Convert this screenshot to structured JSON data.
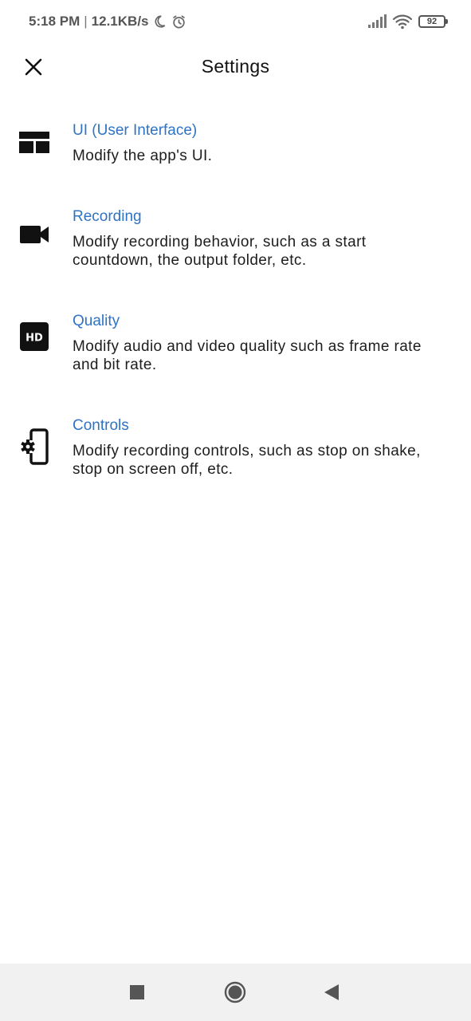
{
  "status_bar": {
    "time": "5:18 PM",
    "separator": "|",
    "net_speed": "12.1KB/s",
    "battery_level": "92",
    "icons": [
      "moon-icon",
      "alarm-icon",
      "signal-icon",
      "wifi-icon",
      "battery-icon"
    ]
  },
  "app_bar": {
    "title": "Settings",
    "close_icon": "close-icon"
  },
  "settings": {
    "accent_color": "#2f73c4",
    "items": [
      {
        "icon": "layout-icon",
        "title": "UI (User Interface)",
        "description": "Modify the app's UI."
      },
      {
        "icon": "videocam-icon",
        "title": "Recording",
        "description": "Modify recording behavior, such as a start countdown, the output folder, etc."
      },
      {
        "icon": "hd-icon",
        "title": "Quality",
        "description": "Modify audio and video quality such as frame rate and bit rate."
      },
      {
        "icon": "phone-settings-icon",
        "title": "Controls",
        "description": "Modify recording controls, such as stop on shake, stop on screen off, etc."
      }
    ]
  },
  "nav_bar": {
    "buttons": [
      "recents-icon",
      "home-icon",
      "back-icon"
    ]
  }
}
